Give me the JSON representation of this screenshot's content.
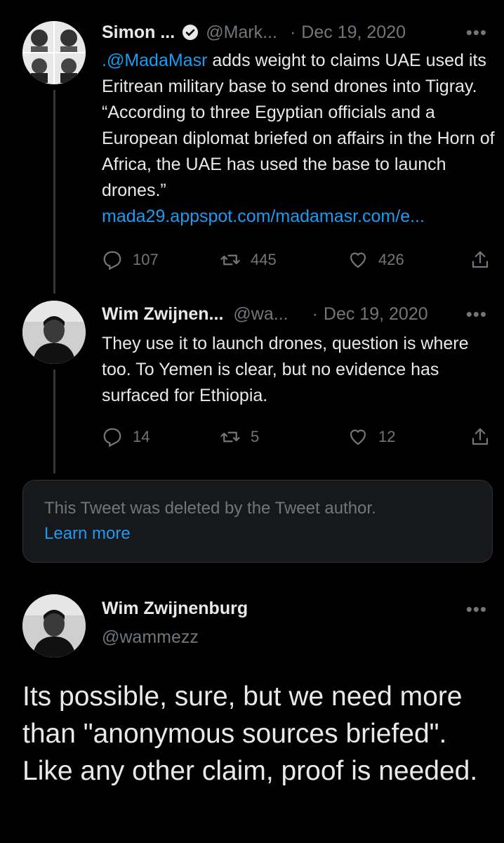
{
  "tweet1": {
    "name": "Simon ...",
    "handle": "@Mark...",
    "separator": "·",
    "date": "Dec 19, 2020",
    "mention": ".@MadaMasr",
    "text": " adds weight to claims UAE used its Eritrean military base to send drones into Tigray. “According to three Egyptian officials and a European diplomat briefed on affairs in the Horn of Africa, the UAE has used the base to launch drones.”",
    "link": "mada29.appspot.com/madamasr.com/e...",
    "replies": "107",
    "retweets": "445",
    "likes": "426",
    "icons": {
      "reply": "reply-icon",
      "retweet": "retweet-icon",
      "like": "heart-icon",
      "share": "share-icon",
      "verified": "verified-badge-icon",
      "more": "more-icon"
    }
  },
  "tweet2": {
    "name": "Wim Zwijnen...",
    "handle": "@wa...",
    "separator": "·",
    "date": "Dec 19, 2020",
    "text": "They use it to launch drones, question is where too. To Yemen is clear, but no evidence has surfaced for Ethiopia.",
    "replies": "14",
    "retweets": "5",
    "likes": "12"
  },
  "deleted": {
    "message": "This Tweet was deleted by the Tweet author.",
    "learn_more": "Learn more"
  },
  "main": {
    "name": "Wim Zwijnenburg",
    "handle": "@wammezz",
    "text": "Its possible, sure, but we need more than \"anonymous sources briefed\". Like any other claim, proof is needed."
  },
  "colors": {
    "background": "#000000",
    "accent": "#1d9bf0",
    "muted": "#71767b",
    "text": "#e7e9ea"
  }
}
